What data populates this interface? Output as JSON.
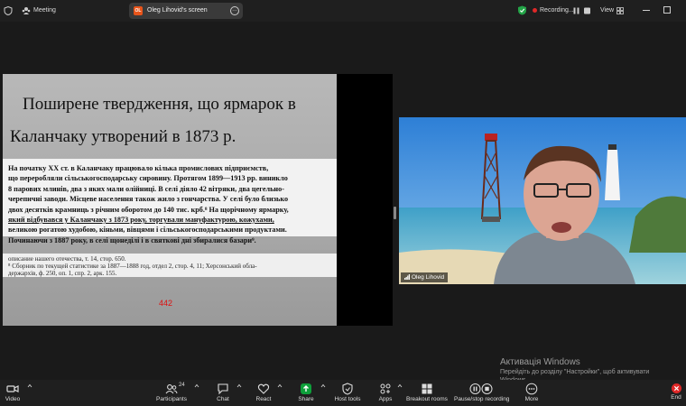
{
  "titlebar": {
    "meeting_label": "Meeting",
    "share_indicator": {
      "avatar_initials": "OL",
      "label": "Oleg Lihovid's screen"
    },
    "recording_label": "Recording...",
    "view_label": "View"
  },
  "slide": {
    "title_line1": "Поширене твердження, що ярмарок в",
    "title_line2": "Каланчаку утворений в 1873 р.",
    "page_lines": [
      "На початку XX ст. в Каланчаку працювало кілька промислових підприємств,",
      "що переробляли сільськогосподарську сировину. Протягом 1899—1913 рр. виникло",
      "8 парових млинів, два з яких мали олійниці. В селі діяло 42 вітряки, два цегельно-",
      "черепичні заводи. Місцеве населення також жило з гончарства. У селі було близько",
      "двох десятків крамниць з річним оборотом до 140 тис. крб.⁸ На щорічному ярмарку,",
      "який відбувався у Каланчаку з 1873 року, торгували мануфактурою, кожухами,",
      "великою рогатою худобою, кіньми, вівцями і сільськогосподарськими продуктами.",
      "Починаючи з 1887 року, в селі щонеділі і в святкові дні збиралися базари⁹."
    ],
    "footnote_lines": [
      "описание нашего отечества, т. 14, стор. 650.",
      "⁸ Сборник по текущей статистике за 1887—1888 год, отдел 2, стор. 4, 11; Херсонський обла-",
      "держархів, ф. 250, оп. 1, спр. 2, арк. 155."
    ],
    "slide_number": "442"
  },
  "video": {
    "participant_name": "Oleg Lihovid"
  },
  "watermark": {
    "line1": "Активація Windows",
    "line2": "Перейдіть до розділу \"Настройки\", щоб активувати",
    "line3": "Windows."
  },
  "toolbar": {
    "video_label": "Video",
    "participants_label": "Participants",
    "participants_count": "24",
    "chat_label": "Chat",
    "react_label": "React",
    "share_label": "Share",
    "host_tools_label": "Host tools",
    "apps_label": "Apps",
    "breakout_label": "Breakout rooms",
    "pause_stop_label": "Pause/stop recording",
    "more_label": "More",
    "end_label": "End"
  },
  "colors": {
    "background": "#1a1a1a",
    "share_green": "#0e9f3a",
    "encryption_green": "#23a447",
    "recording_red": "#e02828",
    "end_red": "#e02828",
    "share_avatar_orange": "#e8541a"
  }
}
